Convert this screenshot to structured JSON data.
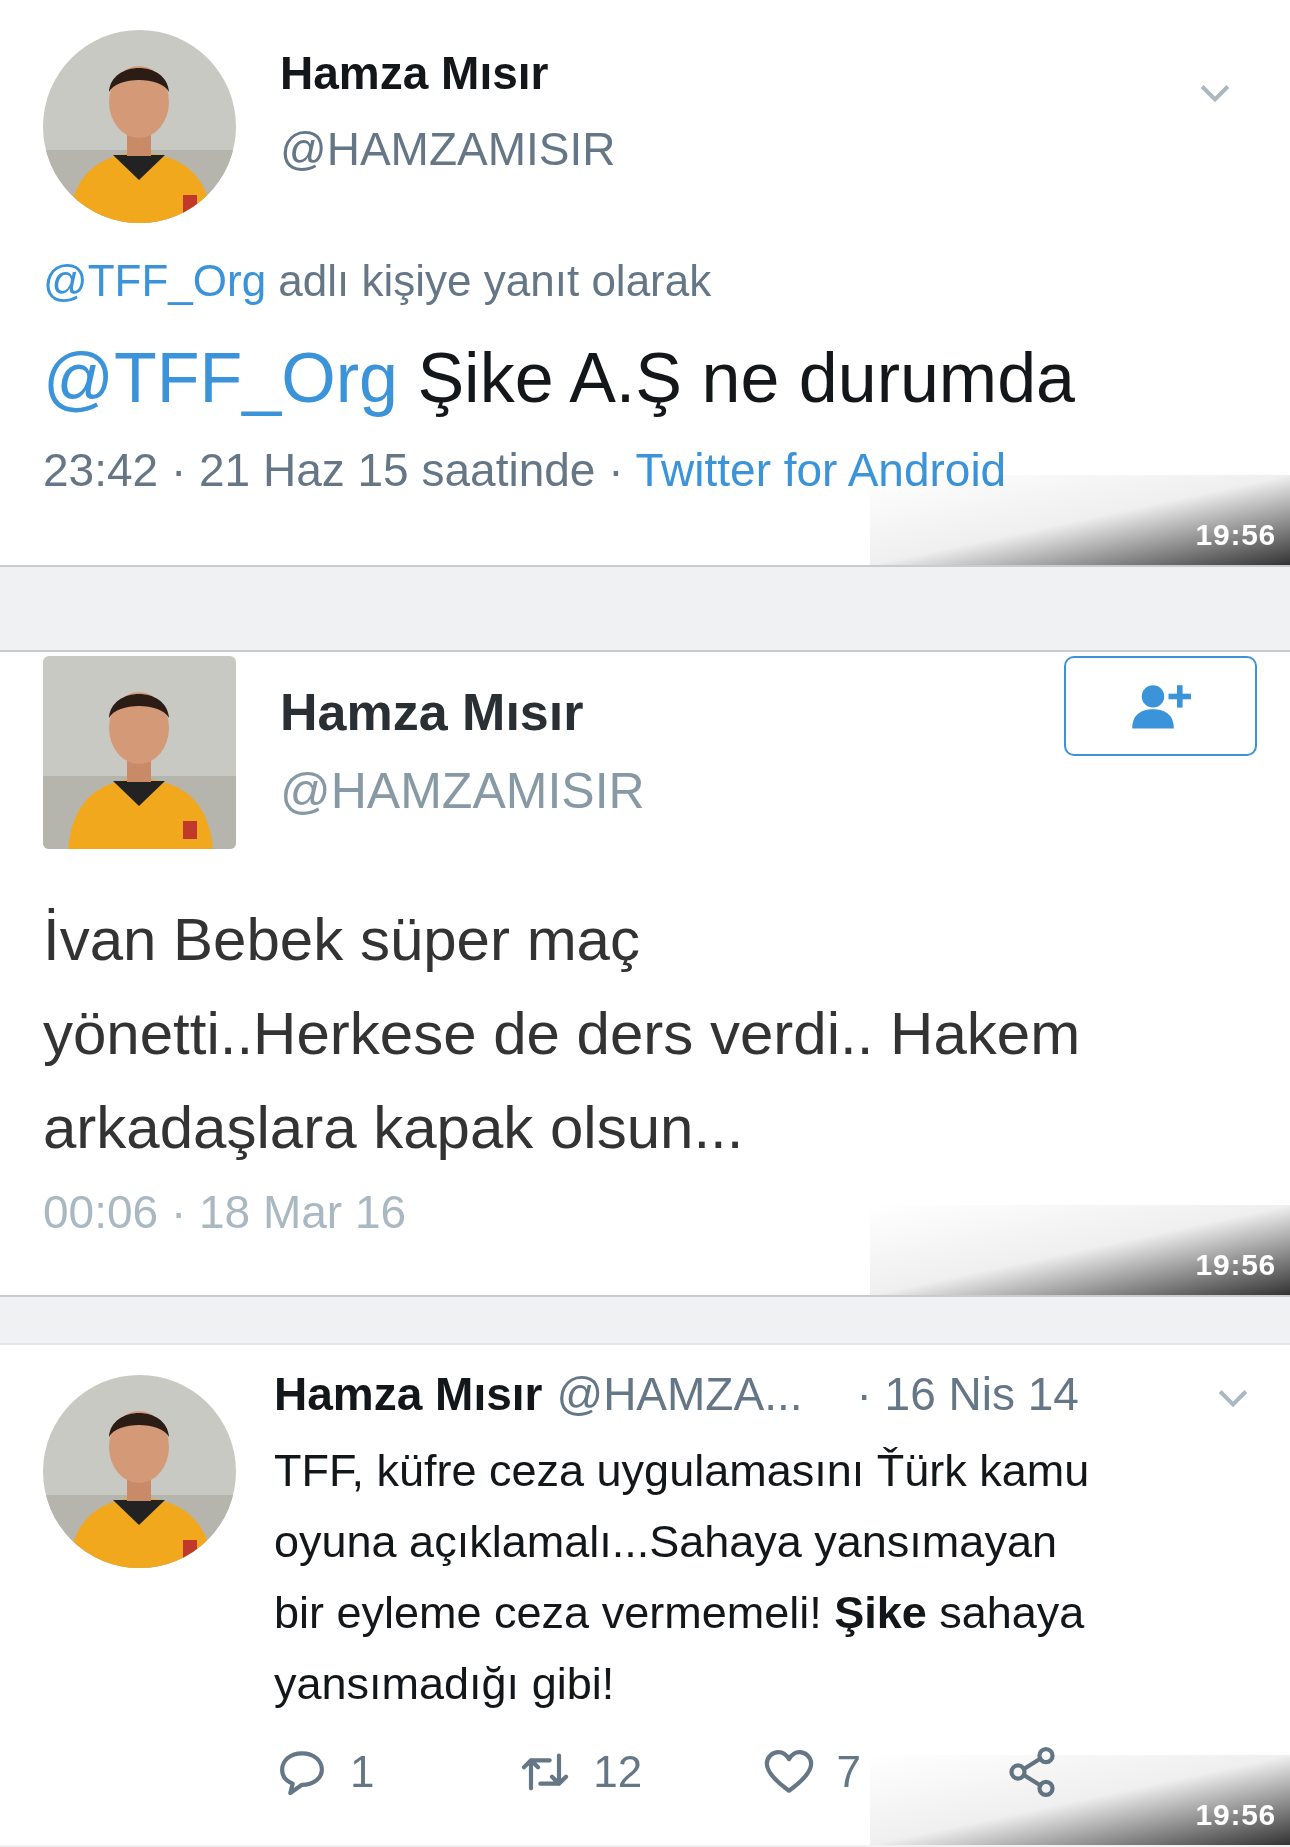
{
  "tweets": [
    {
      "kind": "reply",
      "name": "Hamza Mısır",
      "handle": "@HAMZAMISIR",
      "avatar": {
        "kind": "round"
      },
      "caret": true,
      "reply_to": {
        "mention": "@TFF_Org",
        "text": "adlı kişiye yanıt olarak"
      },
      "body": {
        "mention": "@TFF_Org",
        "text": "Şike A.Ş ne durumda"
      },
      "meta": "23:42 · 21 Haz 15 saatinde ·",
      "source": "Twitter for Android",
      "overlay_time": "19:56"
    },
    {
      "kind": "profile",
      "name": "Hamza Mısır",
      "handle": "@HAMZAMISIR",
      "avatar": {
        "kind": "square"
      },
      "follow_button": true,
      "body": {
        "lines": [
          "İvan Bebek süper maç",
          "yönetti..Herkese de ders verdi.. Hakem",
          "arkadaşlara kapak olsun..."
        ]
      },
      "meta": "00:06 · 18 Mar 16",
      "overlay_time": "19:56"
    },
    {
      "kind": "timeline",
      "name": "Hamza Mısır",
      "handle": "@HAMZA...",
      "date": "· 16 Nis 14",
      "avatar": {
        "kind": "round"
      },
      "caret": true,
      "body": {
        "lines": [
          "TFF, küfre ceza uygulamasını Ťürk kamu",
          "oyuna açıklamalı...Sahaya yansımayan",
          "bir eyleme ceza vermemeli! **Şike** sahaya",
          "yansımadığı gibi!"
        ]
      },
      "stats": [
        {
          "kind": "reply",
          "count": "1"
        },
        {
          "kind": "retweet",
          "count": "12"
        },
        {
          "kind": "like",
          "count": "7"
        },
        {
          "kind": "share"
        }
      ],
      "overlay_time": "19:56"
    }
  ]
}
